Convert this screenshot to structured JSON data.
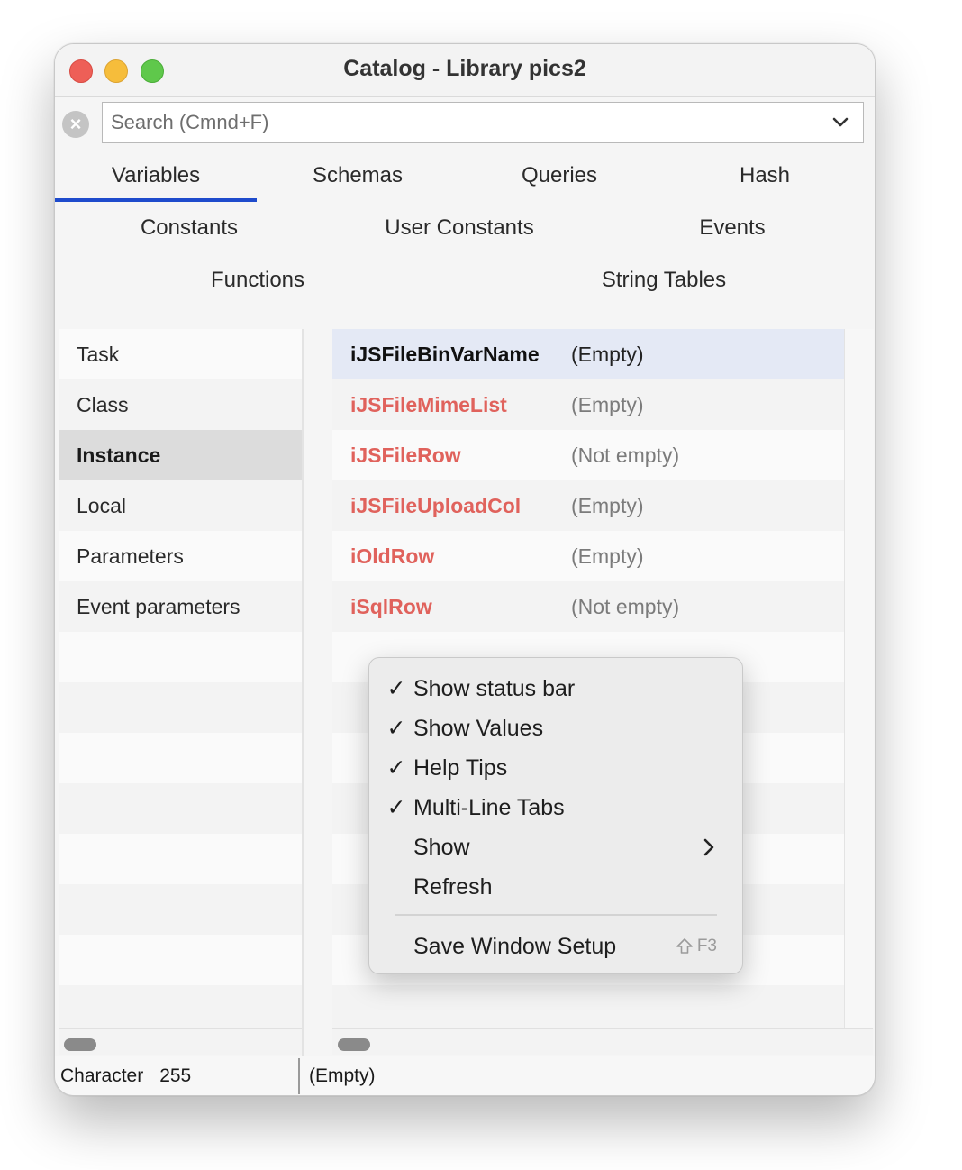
{
  "window": {
    "title": "Catalog - Library pics2"
  },
  "search": {
    "placeholder": "Search (Cmnd+F)",
    "value": ""
  },
  "tabs": {
    "row1": [
      "Variables",
      "Schemas",
      "Queries",
      "Hash"
    ],
    "row2": [
      "Constants",
      "User Constants",
      "Events"
    ],
    "row3": [
      "Functions",
      "String Tables"
    ],
    "active": "Variables"
  },
  "scopes": {
    "items": [
      "Task",
      "Class",
      "Instance",
      "Local",
      "Parameters",
      "Event parameters"
    ],
    "selected": "Instance"
  },
  "variables": [
    {
      "name": "iJSFileBinVarName",
      "value": "(Empty)"
    },
    {
      "name": "iJSFileMimeList",
      "value": "(Empty)"
    },
    {
      "name": "iJSFileRow",
      "value": "(Not empty)"
    },
    {
      "name": "iJSFileUploadCol",
      "value": "(Empty)"
    },
    {
      "name": "iOldRow",
      "value": "(Empty)"
    },
    {
      "name": "iSqlRow",
      "value": "(Not empty)"
    }
  ],
  "status": {
    "type": "Character",
    "length": "255",
    "value": "(Empty)"
  },
  "context_menu": {
    "items": [
      {
        "label": "Show status bar",
        "checked": "✓"
      },
      {
        "label": "Show Values",
        "checked": "✓"
      },
      {
        "label": "Help Tips",
        "checked": "✓"
      },
      {
        "label": "Multi-Line Tabs",
        "checked": "✓"
      },
      {
        "label": "Show",
        "checked": ""
      },
      {
        "label": "Refresh",
        "checked": ""
      }
    ],
    "save_label": "Save Window Setup",
    "save_shortcut": "F3"
  },
  "colors": {
    "accent": "#1e4bcc",
    "variable_name": "#e0625c",
    "selected_row": "#e4e9f5"
  }
}
